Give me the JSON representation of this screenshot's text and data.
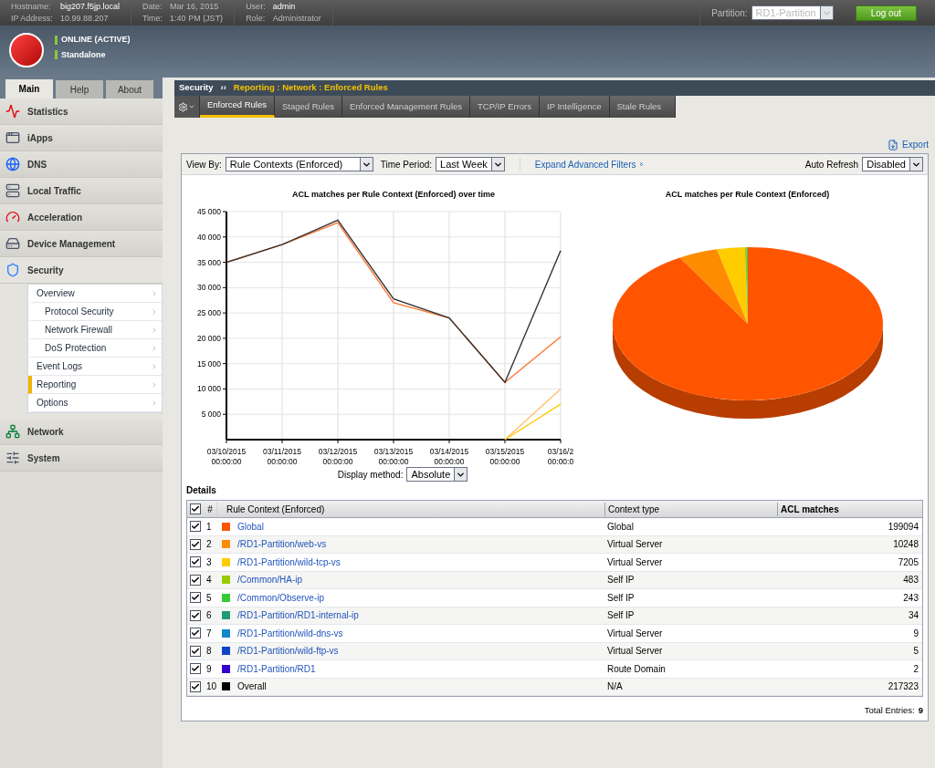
{
  "top_bar": {
    "hostname_label": "Hostname:",
    "hostname": "big207.f5jp.local",
    "ip_label": "IP Address:",
    "ip": "10.99.88.207",
    "date_label": "Date:",
    "date": "Mar 16, 2015",
    "time_label": "Time:",
    "time": "1:40 PM (JST)",
    "user_label": "User:",
    "user": "admin",
    "role_label": "Role:",
    "role": "Administrator",
    "partition_label": "Partition:",
    "partition": "RD1-Partition",
    "logout": "Log out"
  },
  "status": [
    {
      "text": "ONLINE (ACTIVE)",
      "color": "#8cc63f"
    },
    {
      "text": "Standalone",
      "color": "#8cc63f"
    }
  ],
  "nav_tabs": [
    {
      "label": "Main",
      "selected": true
    },
    {
      "label": "Help",
      "selected": false
    },
    {
      "label": "About",
      "selected": false
    }
  ],
  "sidebar": {
    "items": [
      {
        "label": "Statistics",
        "expanded": false
      },
      {
        "label": "iApps",
        "expanded": false
      },
      {
        "label": "DNS",
        "expanded": false
      },
      {
        "label": "Local Traffic",
        "expanded": false
      },
      {
        "label": "Acceleration",
        "expanded": false
      },
      {
        "label": "Device Management",
        "expanded": false
      },
      {
        "label": "Security",
        "expanded": true,
        "children": [
          {
            "label": "Overview",
            "selected": false,
            "children": [
              {
                "label": "Protocol Security",
                "selected": false
              },
              {
                "label": "Network Firewall",
                "selected": false
              },
              {
                "label": "DoS Protection",
                "selected": false
              }
            ]
          },
          {
            "label": "Event Logs",
            "selected": false
          },
          {
            "label": "Reporting",
            "selected": true
          },
          {
            "label": "Options",
            "selected": false
          }
        ]
      },
      {
        "label": "Network",
        "expanded": false
      },
      {
        "label": "System",
        "expanded": false
      }
    ]
  },
  "breadcrumb": {
    "section": "Security",
    "separator": "››",
    "path": "Reporting : Network : Enforced Rules"
  },
  "content_tabs": [
    {
      "label": "Enforced Rules",
      "selected": true
    },
    {
      "label": "Staged Rules",
      "selected": false
    },
    {
      "label": "Enforced Management Rules",
      "selected": false
    },
    {
      "label": "TCP/IP Errors",
      "selected": false
    },
    {
      "label": "IP Intelligence",
      "selected": false
    },
    {
      "label": "Stale Rules",
      "selected": false
    }
  ],
  "export": "Export",
  "filters": {
    "view_by_label": "View By:",
    "view_by": "Rule Contexts (Enforced)",
    "time_period_label": "Time Period:",
    "time_period": "Last Week",
    "advanced": "Expand Advanced Filters",
    "advanced_icon": "»",
    "auto_refresh_label": "Auto Refresh",
    "auto_refresh": "Disabled"
  },
  "line_chart": {
    "chart_data": {
      "type": "line",
      "title": "ACL matches per Rule Context (Enforced) over time",
      "categories": [
        "03/10/2015 00:00:00",
        "03/11/2015 00:00:00",
        "03/12/2015 00:00:00",
        "03/13/2015 00:00:00",
        "03/14/2015 00:00:00",
        "03/15/2015 00:00:00",
        "03/16/2 00:00:0"
      ],
      "series": [
        {
          "color": "#ff7733",
          "values": [
            35000,
            38500,
            42800,
            27000,
            24000,
            11300,
            20300
          ]
        },
        {
          "color": "#ffc070",
          "values": [
            null,
            null,
            null,
            null,
            null,
            0,
            10000
          ]
        },
        {
          "color": "#ffcc00",
          "values": [
            null,
            null,
            null,
            null,
            null,
            0,
            7000
          ]
        },
        {
          "color": "#333333",
          "values": [
            35000,
            38500,
            43300,
            27800,
            24000,
            11300,
            37300
          ]
        }
      ],
      "grid": true,
      "ylim": [
        0,
        45000
      ],
      "yticks": [
        {
          "value": 5000,
          "label": "5 000"
        },
        {
          "value": 10000,
          "label": "10 000"
        },
        {
          "value": 15000,
          "label": "15 000"
        },
        {
          "value": 20000,
          "label": "20 000"
        },
        {
          "value": 25000,
          "label": "25 000"
        },
        {
          "value": 30000,
          "label": "30 000"
        },
        {
          "value": 35000,
          "label": "35 000"
        },
        {
          "value": 40000,
          "label": "40 000"
        },
        {
          "value": 45000,
          "label": "45 000"
        }
      ]
    },
    "display_method_label": "Display method:",
    "display_method": "Absolute"
  },
  "pie_chart": {
    "title": "ACL matches per Rule Context (Enforced)"
  },
  "details": {
    "title": "Details",
    "columns": [
      "#",
      "Rule Context (Enforced)",
      "Context type",
      "ACL matches"
    ],
    "all_checked": true,
    "rows": [
      {
        "checked": true,
        "index": "1",
        "color": "#ff5500",
        "name": "Global",
        "link": true,
        "type": "Global",
        "matches": "199094"
      },
      {
        "checked": true,
        "index": "2",
        "color": "#ff8c00",
        "name": "/RD1-Partition/web-vs",
        "link": true,
        "type": "Virtual Server",
        "matches": "10248"
      },
      {
        "checked": true,
        "index": "3",
        "color": "#ffcc00",
        "name": "/RD1-Partition/wild-tcp-vs",
        "link": true,
        "type": "Virtual Server",
        "matches": "7205"
      },
      {
        "checked": true,
        "index": "4",
        "color": "#99cc00",
        "name": "/Common/HA-ip",
        "link": true,
        "type": "Self IP",
        "matches": "483"
      },
      {
        "checked": true,
        "index": "5",
        "color": "#33cc33",
        "name": "/Common/Observe-ip",
        "link": true,
        "type": "Self IP",
        "matches": "243"
      },
      {
        "checked": true,
        "index": "6",
        "color": "#229977",
        "name": "/RD1-Partition/RD1-internal-ip",
        "link": true,
        "type": "Self IP",
        "matches": "34"
      },
      {
        "checked": true,
        "index": "7",
        "color": "#1188cc",
        "name": "/RD1-Partition/wild-dns-vs",
        "link": true,
        "type": "Virtual Server",
        "matches": "9"
      },
      {
        "checked": true,
        "index": "8",
        "color": "#1144cc",
        "name": "/RD1-Partition/wild-ftp-vs",
        "link": true,
        "type": "Virtual Server",
        "matches": "5"
      },
      {
        "checked": true,
        "index": "9",
        "color": "#3300cc",
        "name": "/RD1-Partition/RD1",
        "link": true,
        "type": "Route Domain",
        "matches": "2"
      },
      {
        "checked": true,
        "index": "10",
        "color": "#000000",
        "name": "Overall",
        "link": false,
        "type": "N/A",
        "matches": "217323"
      }
    ],
    "total_label": "Total Entries:",
    "total": "9"
  }
}
